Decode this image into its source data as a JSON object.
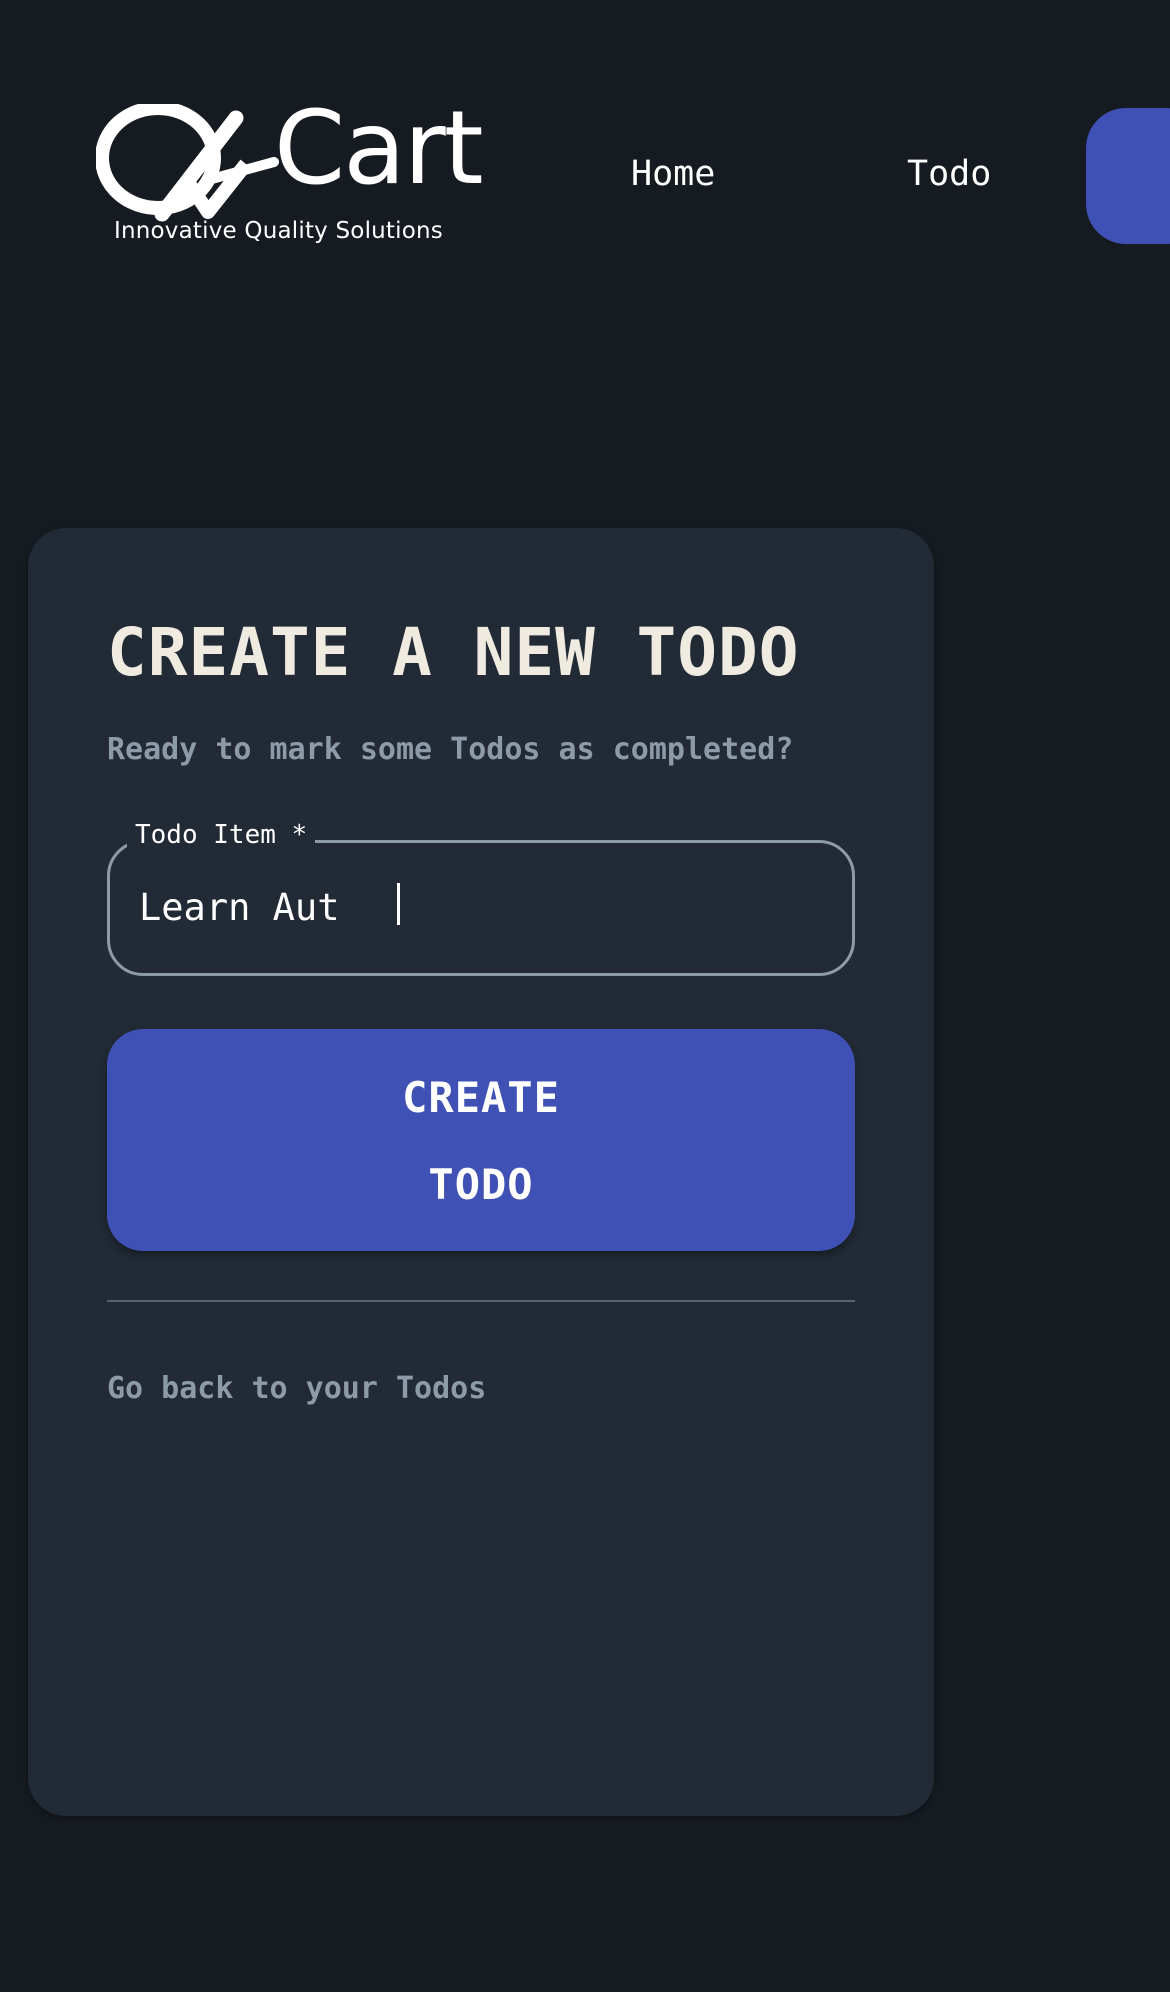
{
  "header": {
    "logo": {
      "text": "QACart",
      "wordmark": "Cart",
      "tagline": "Innovative Quality Solutions"
    },
    "nav": [
      {
        "label": "Home"
      },
      {
        "label": "Todo"
      }
    ],
    "action_button": {
      "color": "#3f51b5",
      "icon": "none-visible"
    }
  },
  "form": {
    "title": "CREATE A NEW TODO",
    "subtitle": "Ready to mark some Todos as completed?",
    "todo_field": {
      "label": "Todo Item *",
      "value": "Learn Aut",
      "focused": true
    },
    "submit": {
      "line1": "CREATE",
      "line2": "TODO"
    },
    "back_link": "Go back to your Todos"
  },
  "colors": {
    "background": "#161b22",
    "card": "#212a35",
    "accent": "#3f51b5",
    "title": "#f0ebe1",
    "muted_text": "#8d9aa7"
  }
}
